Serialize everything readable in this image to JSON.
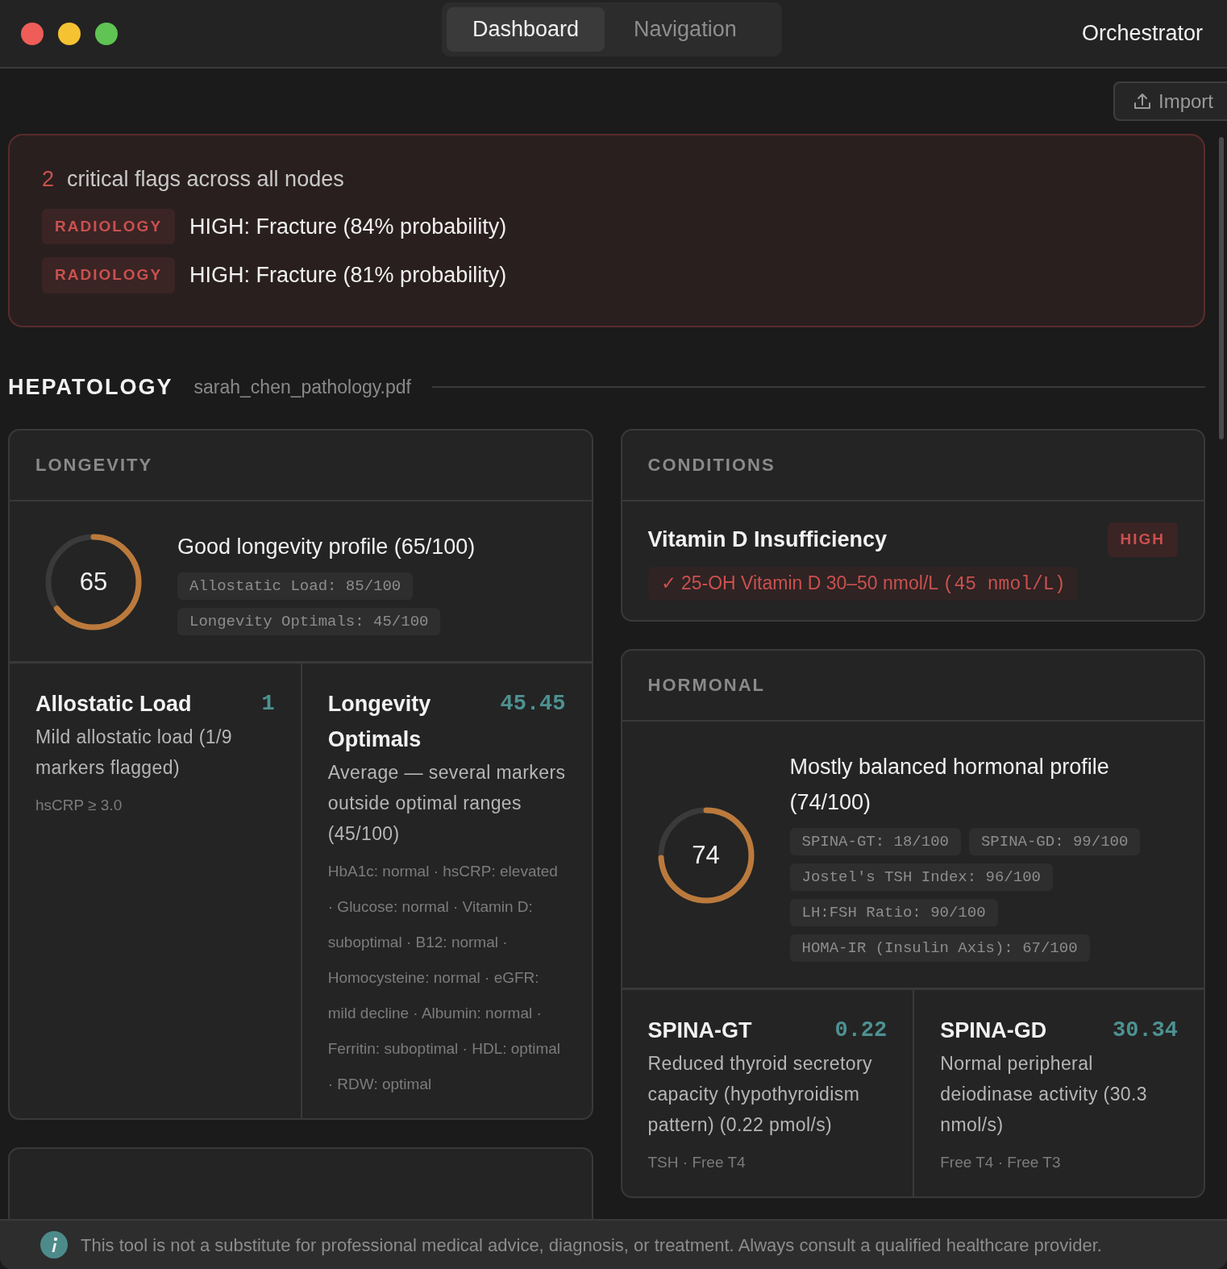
{
  "window": {
    "title": "Orchestrator",
    "tabs": [
      {
        "label": "Dashboard",
        "selected": true
      },
      {
        "label": "Navigation",
        "selected": false
      }
    ]
  },
  "toolbar": {
    "import_button": "Import"
  },
  "alerts": {
    "count": "2",
    "summary": "critical flags across all nodes",
    "flags": [
      {
        "source": "RADIOLOGY",
        "text": "HIGH: Fracture (84% probability)"
      },
      {
        "source": "RADIOLOGY",
        "text": "HIGH: Fracture (81% probability)"
      }
    ]
  },
  "section": {
    "title": "HEPATOLOGY",
    "file": "sarah_chen_pathology.pdf"
  },
  "columns": [
    {
      "cards": [
        {
          "kind": "score",
          "title": "LONGEVITY",
          "score": "65",
          "level": 0.65,
          "summary": "Good longevity profile (65/100)",
          "chips": [
            "Allostatic Load: 85/100",
            "Longevity Optimals: 45/100"
          ],
          "metrics": [
            {
              "name": "Allostatic Load",
              "value": "1",
              "description": "Mild allostatic load (1/9 markers flagged)",
              "details": "hsCRP ≥ 3.0"
            },
            {
              "name": "Longevity Optimals",
              "value": "45.45",
              "description": "Average — several markers outside optimal ranges (45/100)",
              "details": "HbA1c: normal · hsCRP: elevated · Glucose: normal · Vitamin D: suboptimal · B12: normal · Homocysteine: normal · eGFR: mild decline · Albumin: normal · Ferritin: suboptimal · HDL: optimal · RDW: optimal"
            }
          ]
        },
        {
          "kind": "covered"
        }
      ]
    },
    {
      "cards": [
        {
          "kind": "conditions",
          "title": "CONDITIONS",
          "conditions": [
            {
              "name": "Vitamin D Insufficiency",
              "severity": "HIGH",
              "evidence": [
                {
                  "mark": "✓",
                  "text": "25-OH Vitamin D 30–50 nmol/L",
                  "value": "(45 nmol/L)"
                }
              ]
            }
          ]
        },
        {
          "kind": "score",
          "title": "HORMONAL",
          "score": "74",
          "level": 0.74,
          "summary": "Mostly balanced hormonal profile (74/100)",
          "chips": [
            "SPINA-GT: 18/100",
            "SPINA-GD: 99/100",
            "Jostel's TSH Index: 96/100",
            "LH:FSH Ratio: 90/100",
            "HOMA-IR (Insulin Axis): 67/100"
          ],
          "metrics": [
            {
              "name": "SPINA-GT",
              "value": "0.22",
              "description": "Reduced thyroid secretory capacity (hypothyroidism pattern) (0.22 pmol/s)",
              "details": "TSH · Free T4"
            },
            {
              "name": "SPINA-GD",
              "value": "30.34",
              "description": "Normal peripheral deiodinase activity (30.3 nmol/s)",
              "details": "Free T4 · Free T3"
            }
          ]
        }
      ]
    }
  ],
  "footer": {
    "disclaimer": "This tool is not a substitute for professional medical advice, diagnosis, or treatment. Always consult a qualified healthcare provider."
  }
}
